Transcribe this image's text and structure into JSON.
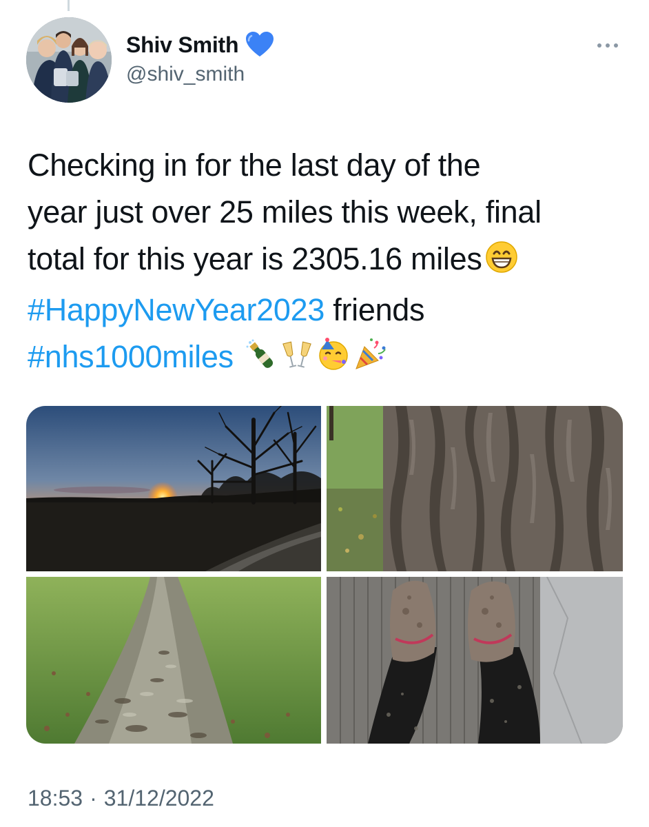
{
  "user": {
    "display_name": "Shiv Smith",
    "handle": "@shiv_smith",
    "badge_icon": "blue-heart-icon",
    "badge_color": "#3b82f6"
  },
  "tweet": {
    "lines": [
      "Checking in for the last day of the",
      "year just over 25 miles this week, final",
      "total for this year is 2305.16 miles"
    ],
    "line3_emoji": "grinning-face-emoji",
    "hashtag_1": "#HappyNewYear2023",
    "after_hashtag_1": " friends",
    "hashtag_2": "#nhs1000miles",
    "trailing_emojis": [
      "bottle-popping-cork-emoji",
      "clinking-glasses-emoji",
      "partying-face-emoji",
      "party-popper-emoji"
    ],
    "hashtag_color": "#1d9bf0"
  },
  "media": [
    {
      "id": "photo-sunset",
      "subject": "sunset"
    },
    {
      "id": "photo-tree-bark",
      "subject": "tree bark"
    },
    {
      "id": "photo-muddy-path",
      "subject": "muddy path"
    },
    {
      "id": "photo-muddy-shoes",
      "subject": "muddy shoes"
    }
  ],
  "meta": {
    "time": "18:53",
    "separator": "·",
    "date": "31/12/2022"
  },
  "more_icon": "more-horizontal-icon"
}
